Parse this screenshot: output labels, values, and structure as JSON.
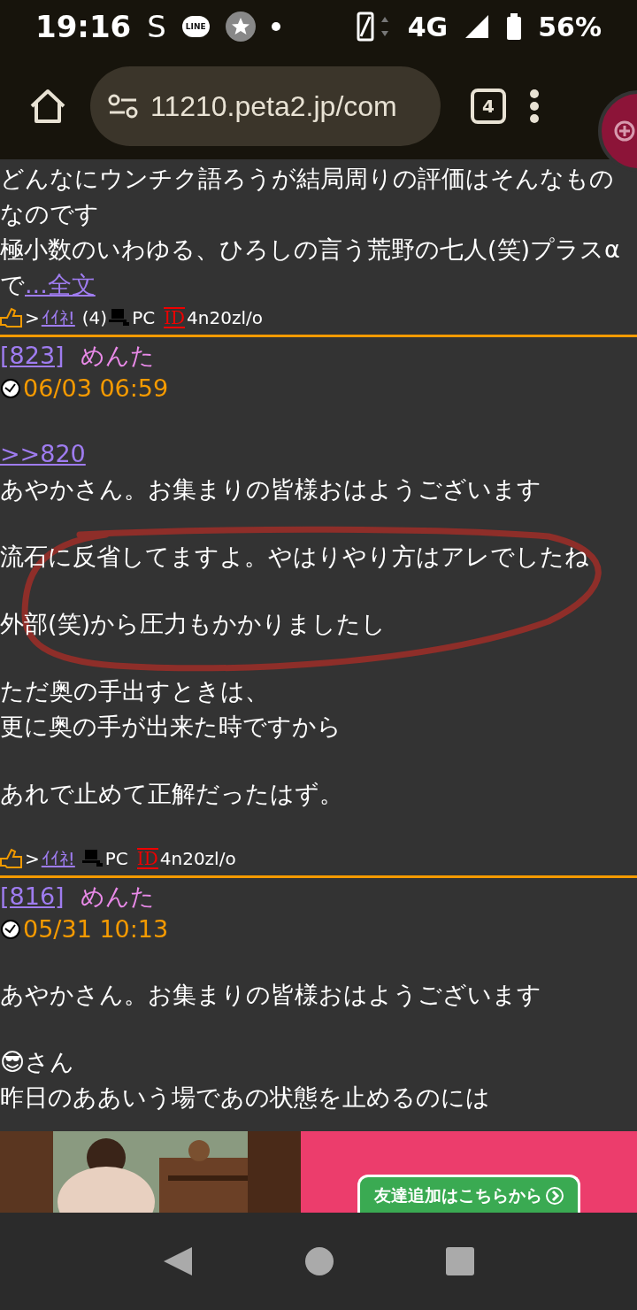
{
  "status_bar": {
    "time": "19:16",
    "app_letter": "S",
    "line_badge": "LINE",
    "network": "4G",
    "battery": "56%"
  },
  "browser": {
    "url": "11210.peta2.jp/com",
    "tab_count": "4"
  },
  "posts": [
    {
      "body": [
        {
          "kind": "text",
          "text": "どんなにウンチク語ろうが結局周りの評価はそんなものなのです"
        },
        {
          "kind": "more",
          "text": "極小数のいわゆる、ひろしの言う荒野の七人(笑)プラスαで",
          "link": "...全文"
        }
      ],
      "footer": {
        "arrow": ">",
        "like": "ｲｲﾈ!",
        "like_count": "(4)",
        "device": "PC",
        "id_label": "ID",
        "id": "4n20zl/o"
      }
    },
    {
      "number": "[823]",
      "name": "めんた",
      "date": "06/03 06:59",
      "body": [
        {
          "kind": "gap"
        },
        {
          "kind": "link",
          "text": ">>820"
        },
        {
          "kind": "text",
          "text": "あやかさん。お集まりの皆様おはようございます"
        },
        {
          "kind": "gap"
        },
        {
          "kind": "text",
          "text": "流石に反省してますよ。やはりやり方はアレでしたね"
        },
        {
          "kind": "gap"
        },
        {
          "kind": "text",
          "text": "外部(笑)から圧力もかかりましたし"
        },
        {
          "kind": "gap"
        },
        {
          "kind": "text",
          "text": "ただ奥の手出すときは、"
        },
        {
          "kind": "text",
          "text": "更に奥の手が出来た時ですから"
        },
        {
          "kind": "gap"
        },
        {
          "kind": "text",
          "text": "あれで止めて正解だったはず。"
        },
        {
          "kind": "gap"
        }
      ],
      "footer": {
        "arrow": ">",
        "like": "ｲｲﾈ!",
        "device": "PC",
        "id_label": "ID",
        "id": "4n20zl/o"
      }
    },
    {
      "number": "[816]",
      "name": "めんた",
      "date": "05/31 10:13",
      "body": [
        {
          "kind": "gap"
        },
        {
          "kind": "text",
          "text": "あやかさん。お集まりの皆様おはようございます"
        },
        {
          "kind": "gap"
        },
        {
          "kind": "text",
          "text": "😎さん"
        },
        {
          "kind": "text",
          "text": "昨日のああいう場であの状態を止めるのには"
        }
      ]
    }
  ],
  "ad": {
    "kind": "picture",
    "button": "友達追加はこちらから"
  }
}
